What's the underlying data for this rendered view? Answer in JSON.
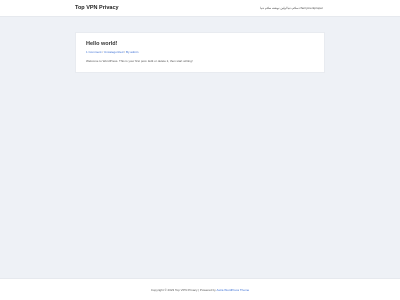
{
  "header": {
    "site_title": "Top VPN Privacy",
    "right_text": "سلام دنیا اولین نوشته سلام دنیا cherrymentproper"
  },
  "post": {
    "title": "Hello world!",
    "meta": {
      "comments": "1 Comment",
      "category": "Uncategorized",
      "author": "By admin",
      "separator": "/"
    },
    "excerpt": "Welcome to WordPress. This is your first post. Edit or delete it, then start writing!"
  },
  "footer": {
    "copyright": "Copyright © 2023 Top VPN Privacy | Powered by",
    "theme_link": "Astra WordPress Theme"
  },
  "colors": {
    "page_bg": "#eef1f6",
    "card_bg": "#ffffff",
    "link": "#3b6fd4"
  }
}
